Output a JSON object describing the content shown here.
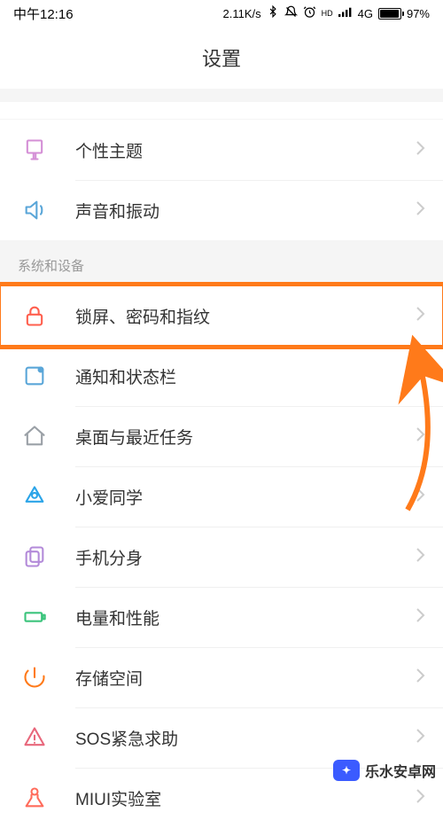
{
  "status_bar": {
    "time": "中午12:16",
    "speed": "2.11K/s",
    "network_label": "4G",
    "hd_label": "HD",
    "battery_pct": "97%",
    "battery_fill_width": "97%"
  },
  "header": {
    "title": "设置"
  },
  "top_rows": [
    {
      "id": "theme",
      "label": "个性主题",
      "icon": "theme-icon",
      "icon_color": "#d48fd6"
    },
    {
      "id": "sound",
      "label": "声音和振动",
      "icon": "sound-icon",
      "icon_color": "#5aa6d8"
    }
  ],
  "section_system": {
    "title": "系统和设备",
    "rows": [
      {
        "id": "lock",
        "label": "锁屏、密码和指纹",
        "icon": "lock-icon",
        "icon_color": "#ff5f4e",
        "highlighted": true
      },
      {
        "id": "notify",
        "label": "通知和状态栏",
        "icon": "notify-icon",
        "icon_color": "#5aa6d8"
      },
      {
        "id": "desktop",
        "label": "桌面与最近任务",
        "icon": "home-icon",
        "icon_color": "#9aa0a6"
      },
      {
        "id": "xiaoai",
        "label": "小爱同学",
        "icon": "xiaoai-icon",
        "icon_color": "#2aa4e8"
      },
      {
        "id": "clone",
        "label": "手机分身",
        "icon": "clone-icon",
        "icon_color": "#b38ad9"
      },
      {
        "id": "battery",
        "label": "电量和性能",
        "icon": "battery-icon",
        "icon_color": "#3cc47c"
      },
      {
        "id": "storage",
        "label": "存储空间",
        "icon": "storage-icon",
        "icon_color": "#ff7a1a"
      },
      {
        "id": "sos",
        "label": "SOS紧急求助",
        "icon": "sos-icon",
        "icon_color": "#e8677b"
      },
      {
        "id": "lab",
        "label": "MIUI实验室",
        "icon": "lab-icon",
        "icon_color": "#ff6b5b"
      }
    ]
  },
  "watermark": {
    "text": "乐水安卓网"
  },
  "colors": {
    "highlight": "#ff7a1a",
    "chevron": "#cccccc"
  }
}
